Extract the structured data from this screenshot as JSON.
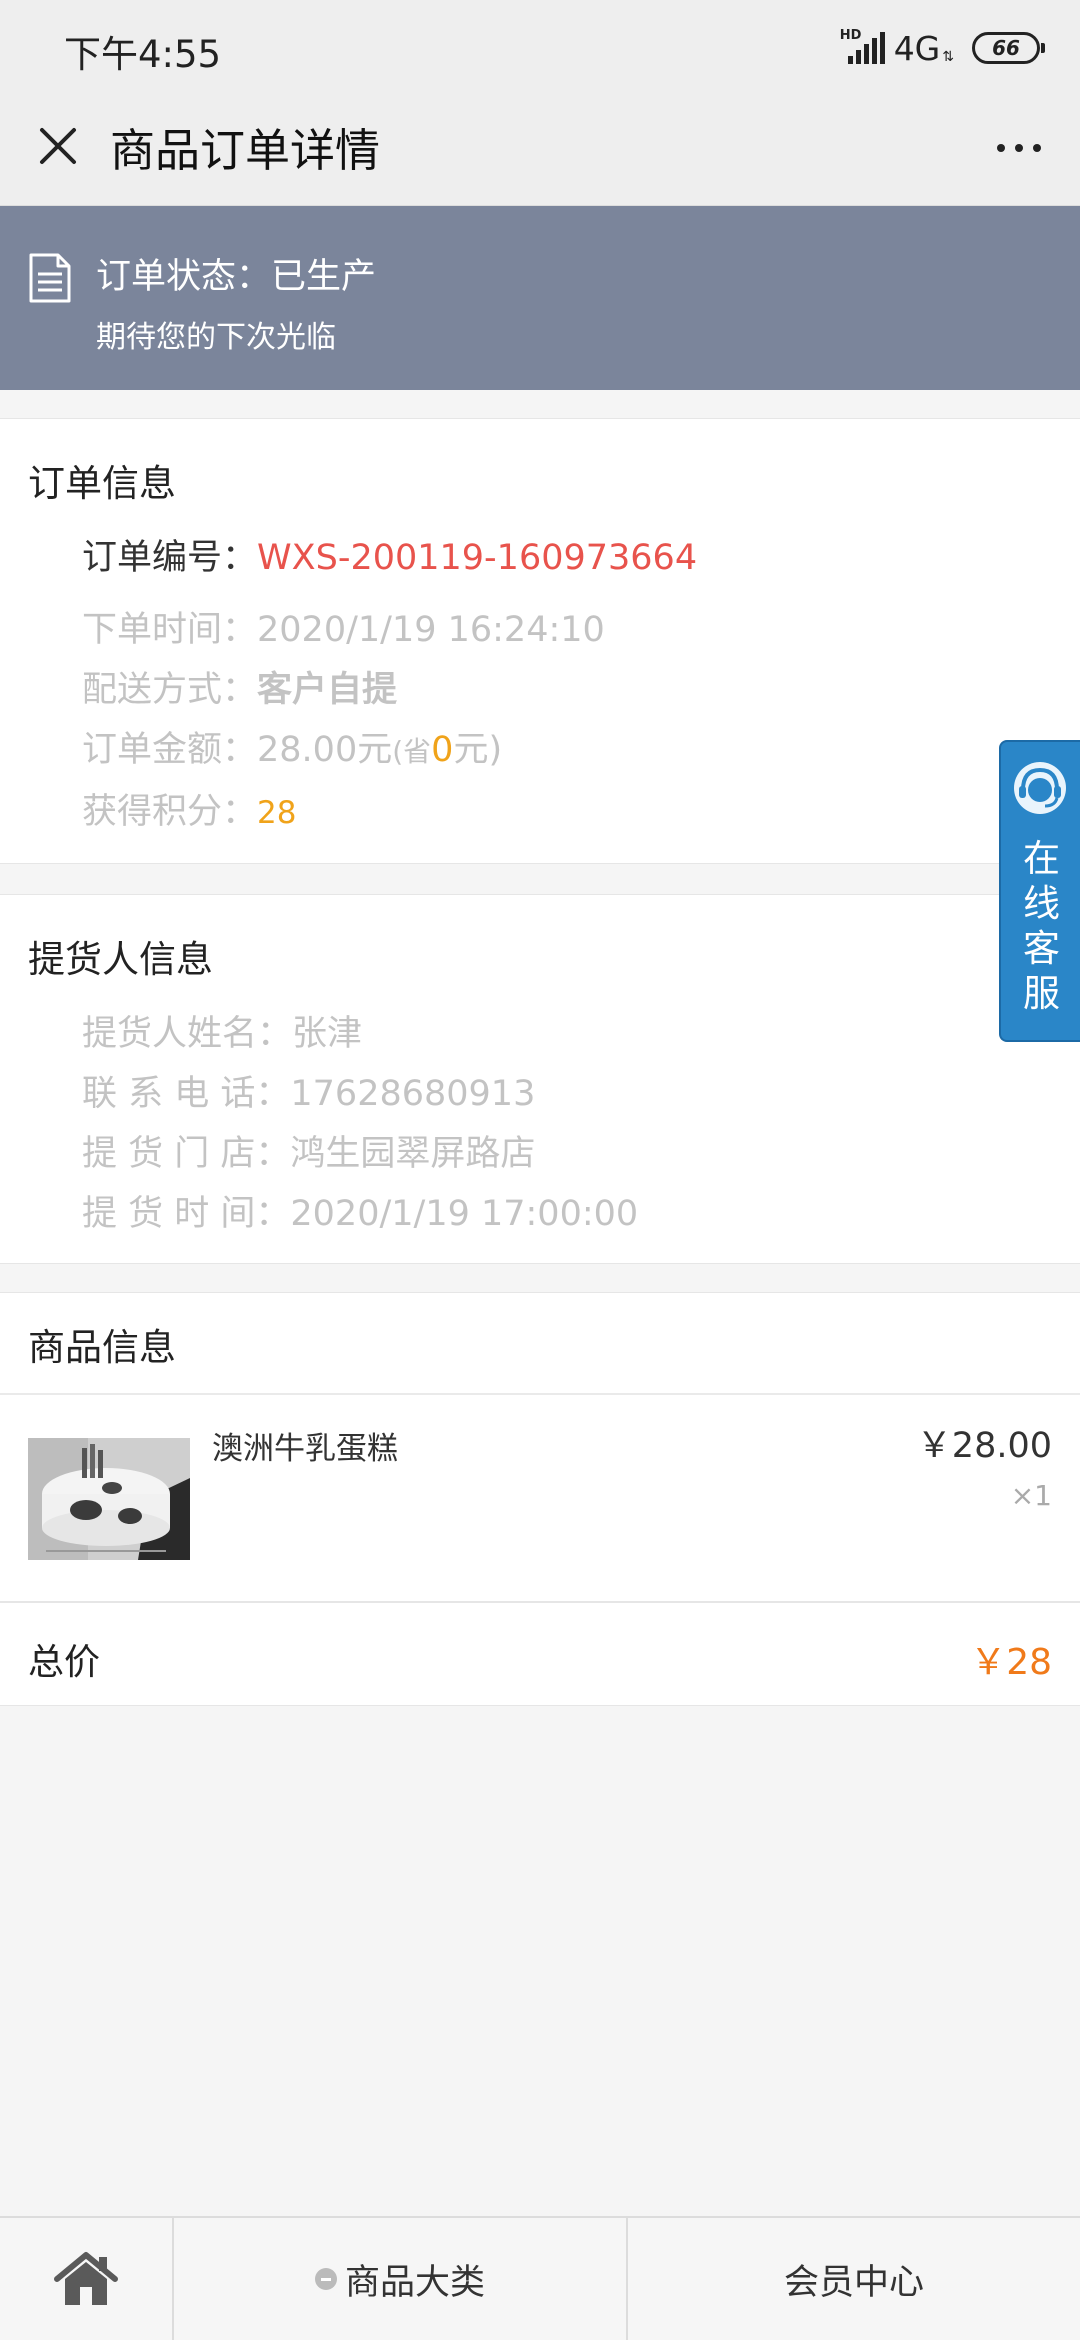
{
  "status_bar": {
    "time": "下午4:55",
    "signal_label": "HD",
    "network": "4G",
    "battery": "66"
  },
  "nav": {
    "title": "商品订单详情"
  },
  "order_status": {
    "status_text": "订单状态：已生产",
    "subtitle": "期待您的下次光临"
  },
  "order_info": {
    "section_title": "订单信息",
    "order_no_label": "订单编号：",
    "order_no": "WXS-200119-160973664",
    "order_time_label": "下单时间：",
    "order_time": "2020/1/19 16:24:10",
    "delivery_label": "配送方式：",
    "delivery": "客户自提",
    "amount_label": "订单金额：",
    "amount": "28.00元",
    "saved_prefix": "(省",
    "saved_value": "0",
    "saved_suffix": "元)",
    "points_label": "获得积分：",
    "points": "28"
  },
  "pickup_info": {
    "section_title": "提货人信息",
    "name_label": "提货人姓名：",
    "name": "张津",
    "phone_label": "联 系 电 话：",
    "phone": "17628680913",
    "store_label": "提 货 门 店：",
    "store": "鸿生园翠屏路店",
    "time_label": "提 货 时 间：",
    "time": "2020/1/19 17:00:00"
  },
  "product_info": {
    "section_title": "商品信息",
    "items": [
      {
        "name": "澳洲牛乳蛋糕",
        "price": "￥28.00",
        "qty": "×1"
      }
    ]
  },
  "total": {
    "label": "总价",
    "value": "￥28"
  },
  "customer_service": {
    "chars": [
      "在",
      "线",
      "客",
      "服"
    ]
  },
  "tabbar": {
    "category_label": "商品大类",
    "member_label": "会员中心"
  },
  "colors": {
    "banner_bg": "#7b859b",
    "order_no": "#e8534c",
    "points": "#f0a31a",
    "total": "#f07a1a",
    "service_bg": "#2a86c8"
  }
}
